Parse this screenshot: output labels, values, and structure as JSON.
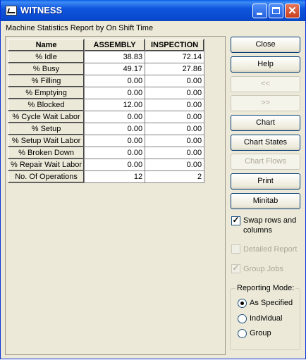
{
  "window": {
    "title": "WITNESS"
  },
  "subtitle": "Machine Statistics   Report by On Shift Time",
  "table": {
    "headers": [
      "Name",
      "ASSEMBLY",
      "INSPECTION"
    ],
    "rows": [
      {
        "name": "% Idle",
        "values": [
          "38.83",
          "72.14"
        ]
      },
      {
        "name": "% Busy",
        "values": [
          "49.17",
          "27.86"
        ]
      },
      {
        "name": "% Filling",
        "values": [
          "0.00",
          "0.00"
        ]
      },
      {
        "name": "% Emptying",
        "values": [
          "0.00",
          "0.00"
        ]
      },
      {
        "name": "% Blocked",
        "values": [
          "12.00",
          "0.00"
        ]
      },
      {
        "name": "% Cycle Wait Labor",
        "values": [
          "0.00",
          "0.00"
        ]
      },
      {
        "name": "% Setup",
        "values": [
          "0.00",
          "0.00"
        ]
      },
      {
        "name": "% Setup Wait Labor",
        "values": [
          "0.00",
          "0.00"
        ]
      },
      {
        "name": "% Broken Down",
        "values": [
          "0.00",
          "0.00"
        ]
      },
      {
        "name": "% Repair Wait Labor",
        "values": [
          "0.00",
          "0.00"
        ]
      },
      {
        "name": "No. Of Operations",
        "values": [
          "12",
          "2"
        ]
      }
    ]
  },
  "buttons": {
    "close": "Close",
    "help": "Help",
    "prev": "<<",
    "next": ">>",
    "chart": "Chart",
    "chart_states": "Chart States",
    "chart_flows": "Chart Flows",
    "print": "Print",
    "minitab": "Minitab"
  },
  "options": {
    "swap_rows": {
      "label_line1": "Swap rows and",
      "label_line2": "columns",
      "checked": true
    },
    "detailed_report": {
      "label": "Detailed Report",
      "checked": false,
      "enabled": false
    },
    "group_jobs": {
      "label": "Group Jobs",
      "checked": true,
      "enabled": false
    }
  },
  "reporting_mode": {
    "legend": "Reporting Mode:",
    "options": [
      "As Specified",
      "Individual",
      "Group"
    ],
    "selected": "As Specified"
  },
  "icons": {
    "app": "witness-app-icon",
    "minimize": "minimize-icon",
    "maximize": "maximize-icon",
    "close": "close-icon"
  }
}
